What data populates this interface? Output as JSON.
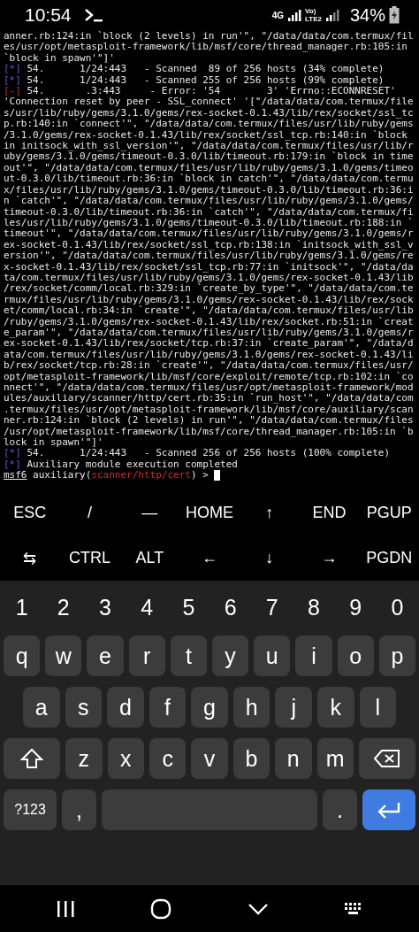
{
  "status_bar": {
    "time": "10:54",
    "network": "4G",
    "volte_top": "Vo)",
    "volte_bottom": "LTE2",
    "battery": "34%"
  },
  "terminal": {
    "lines": [
      {
        "kind": "plain",
        "text": "anner.rb:124:in `block (2 levels) in run'\", \"/data/data/com.termux/fil"
      },
      {
        "kind": "plain",
        "text": "es/usr/opt/metasploit-framework/lib/msf/core/thread_manager.rb:105:in"
      },
      {
        "kind": "plain",
        "text": "`block in spawn'\"]'"
      },
      {
        "kind": "info",
        "mark": "[*]",
        "text": "54.      1/24:443   - Scanned  89 of 256 hosts (34% complete)"
      },
      {
        "kind": "info",
        "mark": "[*]",
        "text": "54.      1/24:443   - Scanned 255 of 256 hosts (99% complete)"
      },
      {
        "kind": "error",
        "mark": "[-]",
        "text": "54.       .3:443     - Error: '54        3' 'Errno::ECONNRESET'"
      },
      {
        "kind": "plain",
        "text": "'Connection reset by peer - SSL_connect' '[\"/data/data/com.termux/file"
      },
      {
        "kind": "plain",
        "text": "s/usr/lib/ruby/gems/3.1.0/gems/rex-socket-0.1.43/lib/rex/socket/ssl_tc"
      },
      {
        "kind": "plain",
        "text": "p.rb:140:in `connect'\", \"/data/data/com.termux/files/usr/lib/ruby/gems"
      },
      {
        "kind": "plain",
        "text": "/3.1.0/gems/rex-socket-0.1.43/lib/rex/socket/ssl_tcp.rb:140:in `block"
      },
      {
        "kind": "plain",
        "text": "in initsock_with_ssl_version'\", \"/data/data/com.termux/files/usr/lib/r"
      },
      {
        "kind": "plain",
        "text": "uby/gems/3.1.0/gems/timeout-0.3.0/lib/timeout.rb:179:in `block in time"
      },
      {
        "kind": "plain",
        "text": "out'\", \"/data/data/com.termux/files/usr/lib/ruby/gems/3.1.0/gems/timeo"
      },
      {
        "kind": "plain",
        "text": "ut-0.3.0/lib/timeout.rb:36:in `block in catch'\", \"/data/data/com.termu"
      },
      {
        "kind": "plain",
        "text": "x/files/usr/lib/ruby/gems/3.1.0/gems/timeout-0.3.0/lib/timeout.rb:36:i"
      },
      {
        "kind": "plain",
        "text": "n `catch'\", \"/data/data/com.termux/files/usr/lib/ruby/gems/3.1.0/gems/"
      },
      {
        "kind": "plain",
        "text": "timeout-0.3.0/lib/timeout.rb:36:in `catch'\", \"/data/data/com.termux/fi"
      },
      {
        "kind": "plain",
        "text": "les/usr/lib/ruby/gems/3.1.0/gems/timeout-0.3.0/lib/timeout.rb:188:in `"
      },
      {
        "kind": "plain",
        "text": "timeout'\", \"/data/data/com.termux/files/usr/lib/ruby/gems/3.1.0/gems/r"
      },
      {
        "kind": "plain",
        "text": "ex-socket-0.1.43/lib/rex/socket/ssl_tcp.rb:138:in `initsock_with_ssl_v"
      },
      {
        "kind": "plain",
        "text": "ersion'\", \"/data/data/com.termux/files/usr/lib/ruby/gems/3.1.0/gems/re"
      },
      {
        "kind": "plain",
        "text": "x-socket-0.1.43/lib/rex/socket/ssl_tcp.rb:77:in `initsock'\", \"/data/da"
      },
      {
        "kind": "plain",
        "text": "ta/com.termux/files/usr/lib/ruby/gems/3.1.0/gems/rex-socket-0.1.43/lib"
      },
      {
        "kind": "plain",
        "text": "/rex/socket/comm/local.rb:329:in `create_by_type'\", \"/data/data/com.te"
      },
      {
        "kind": "plain",
        "text": "rmux/files/usr/lib/ruby/gems/3.1.0/gems/rex-socket-0.1.43/lib/rex/sock"
      },
      {
        "kind": "plain",
        "text": "et/comm/local.rb:34:in `create'\", \"/data/data/com.termux/files/usr/lib"
      },
      {
        "kind": "plain",
        "text": "/ruby/gems/3.1.0/gems/rex-socket-0.1.43/lib/rex/socket.rb:51:in `creat"
      },
      {
        "kind": "plain",
        "text": "e_param'\", \"/data/data/com.termux/files/usr/lib/ruby/gems/3.1.0/gems/r"
      },
      {
        "kind": "plain",
        "text": "ex-socket-0.1.43/lib/rex/socket/tcp.rb:37:in `create_param'\", \"/data/d"
      },
      {
        "kind": "plain",
        "text": "ata/com.termux/files/usr/lib/ruby/gems/3.1.0/gems/rex-socket-0.1.43/li"
      },
      {
        "kind": "plain",
        "text": "b/rex/socket/tcp.rb:28:in `create'\", \"/data/data/com.termux/files/usr/"
      },
      {
        "kind": "plain",
        "text": "opt/metasploit-framework/lib/msf/core/exploit/remote/tcp.rb:102:in `co"
      },
      {
        "kind": "plain",
        "text": "nnect'\", \"/data/data/com.termux/files/usr/opt/metasploit-framework/mod"
      },
      {
        "kind": "plain",
        "text": "ules/auxiliary/scanner/http/cert.rb:35:in `run_host'\", \"/data/data/com"
      },
      {
        "kind": "plain",
        "text": ".termux/files/usr/opt/metasploit-framework/lib/msf/core/auxiliary/scan"
      },
      {
        "kind": "plain",
        "text": "ner.rb:124:in `block (2 levels) in run'\", \"/data/data/com.termux/files"
      },
      {
        "kind": "plain",
        "text": "/usr/opt/metasploit-framework/lib/msf/core/thread_manager.rb:105:in `b"
      },
      {
        "kind": "plain",
        "text": "lock in spawn'\"]'"
      },
      {
        "kind": "info",
        "mark": "[*]",
        "text": "54.      1/24:443   - Scanned 256 of 256 hosts (100% complete)"
      },
      {
        "kind": "info",
        "mark": "[*]",
        "text": "Auxiliary module execution completed"
      }
    ],
    "prompt": {
      "name": "msf6",
      "before": "auxiliary(",
      "module": "scanner/http/cert",
      "after": ") >"
    }
  },
  "extra_keys": [
    [
      "ESC",
      "/",
      "—",
      "HOME",
      "↑",
      "END",
      "PGUP"
    ],
    [
      "⇆",
      "CTRL",
      "ALT",
      "←",
      "↓",
      "→",
      "PGDN"
    ]
  ],
  "keyboard": {
    "number_row": [
      "1",
      "2",
      "3",
      "4",
      "5",
      "6",
      "7",
      "8",
      "9",
      "0"
    ],
    "rows": [
      [
        {
          "kind": "letter",
          "label": "q"
        },
        {
          "kind": "letter",
          "label": "w"
        },
        {
          "kind": "letter",
          "label": "e"
        },
        {
          "kind": "letter",
          "label": "r"
        },
        {
          "kind": "letter",
          "label": "t"
        },
        {
          "kind": "letter",
          "label": "y"
        },
        {
          "kind": "letter",
          "label": "u"
        },
        {
          "kind": "letter",
          "label": "i"
        },
        {
          "kind": "letter",
          "label": "o"
        },
        {
          "kind": "letter",
          "label": "p"
        }
      ],
      [
        {
          "kind": "letter",
          "label": "a"
        },
        {
          "kind": "letter",
          "label": "s"
        },
        {
          "kind": "letter",
          "label": "d"
        },
        {
          "kind": "letter",
          "label": "f"
        },
        {
          "kind": "letter",
          "label": "g"
        },
        {
          "kind": "letter",
          "label": "h"
        },
        {
          "kind": "letter",
          "label": "j"
        },
        {
          "kind": "letter",
          "label": "k"
        },
        {
          "kind": "letter",
          "label": "l"
        }
      ],
      [
        {
          "kind": "shift"
        },
        {
          "kind": "letter",
          "label": "z"
        },
        {
          "kind": "letter",
          "label": "x"
        },
        {
          "kind": "letter",
          "label": "c"
        },
        {
          "kind": "letter",
          "label": "v"
        },
        {
          "kind": "letter",
          "label": "b"
        },
        {
          "kind": "letter",
          "label": "n"
        },
        {
          "kind": "letter",
          "label": "m"
        },
        {
          "kind": "backspace"
        }
      ]
    ],
    "bottom_row": [
      {
        "kind": "mode",
        "label": "?123"
      },
      {
        "kind": "letter",
        "label": ","
      },
      {
        "kind": "space"
      },
      {
        "kind": "letter",
        "label": "."
      },
      {
        "kind": "enter"
      }
    ]
  }
}
